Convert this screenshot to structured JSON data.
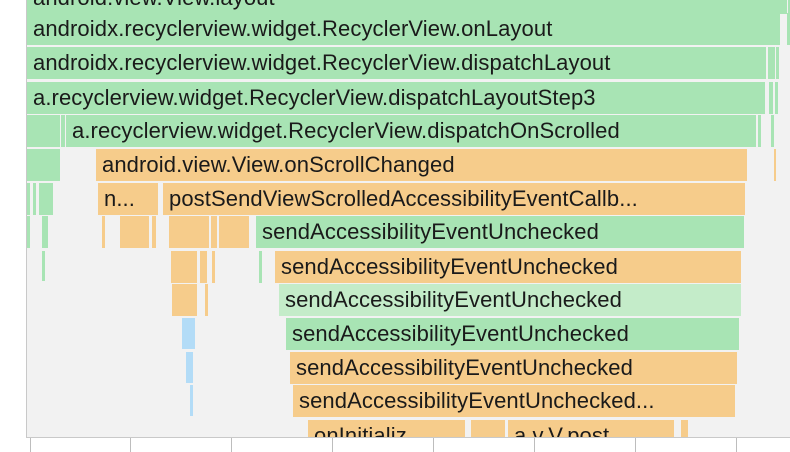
{
  "flame_chart": {
    "frames": {
      "view_layout": "android.view.View.layout",
      "on_layout": "androidx.recyclerview.widget.RecyclerView.onLayout",
      "dispatch_layout": "androidx.recyclerview.widget.RecyclerView.dispatchLayout",
      "dispatch_layout_step3": "a.recyclerview.widget.RecyclerView.dispatchLayoutStep3",
      "dispatch_on_scrolled": "a.recyclerview.widget.RecyclerView.dispatchOnScrolled",
      "on_scroll_changed": "android.view.View.onScrollChanged",
      "n_truncated": "n...",
      "post_send": "postSendViewScrolledAccessibilityEventCallb...",
      "send_1": "sendAccessibilityEventUnchecked",
      "send_2": "sendAccessibilityEventUnchecked",
      "send_3": "sendAccessibilityEventUnchecked",
      "send_4": "sendAccessibilityEventUnchecked",
      "send_5": "sendAccessibilityEventUnchecked",
      "send_6": "sendAccessibilityEventUnchecked...",
      "on_initializ": "onInitializ...",
      "a_v_v_post": "a.v.V.post"
    },
    "colors": {
      "green": "#a8e4b4",
      "pale_green": "#c4ecc9",
      "orange": "#f6cc8b",
      "blue": "#b3dcf7",
      "background": "#f2f2f2"
    }
  }
}
